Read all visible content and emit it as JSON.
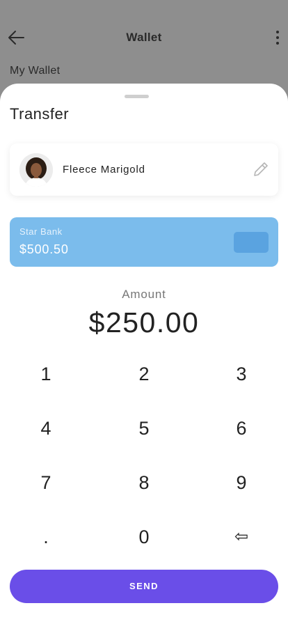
{
  "header": {
    "title": "Wallet",
    "back_icon": "arrow-left-icon",
    "menu_icon": "more-vertical-icon"
  },
  "background": {
    "subtitle": "My Wallet"
  },
  "sheet": {
    "title": "Transfer",
    "recipient": {
      "name": "Fleece Marigold",
      "edit_icon": "pencil-icon"
    },
    "bank_card": {
      "bank_name": "Star Bank",
      "balance": "$500.50",
      "color": "#7bbcec"
    },
    "amount": {
      "label": "Amount",
      "value": "$250.00"
    },
    "keypad": {
      "keys": [
        "1",
        "2",
        "3",
        "4",
        "5",
        "6",
        "7",
        "8",
        "9",
        ".",
        "0",
        "⇦"
      ]
    },
    "send_label": "SEND",
    "accent_color": "#6a4ee8"
  }
}
